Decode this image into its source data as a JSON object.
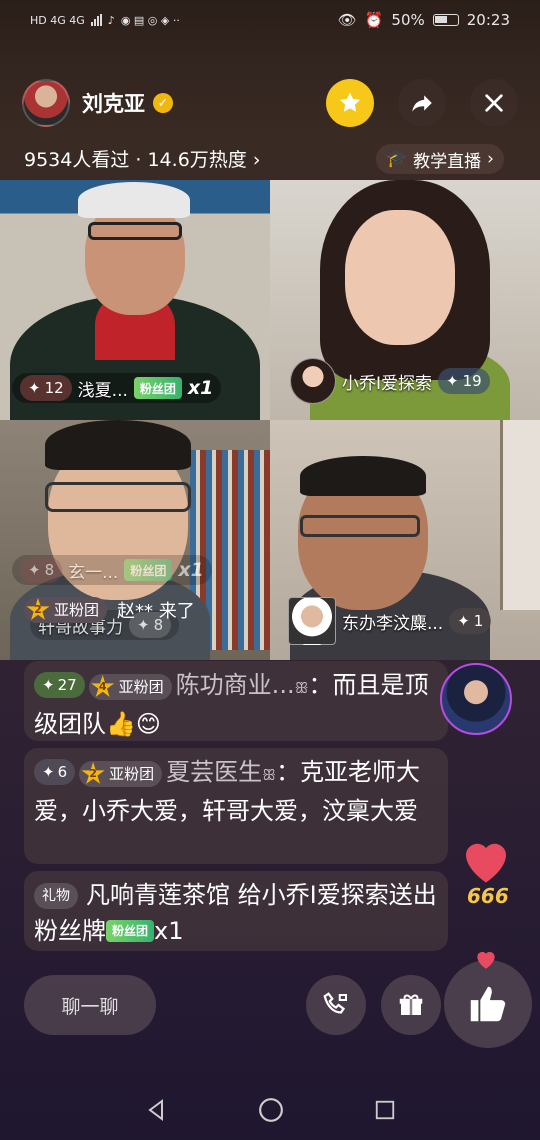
{
  "status": {
    "network": "HD 4G 4G",
    "battery": "50%",
    "time": "20:23"
  },
  "header": {
    "host_name": "刘克亚",
    "viewers": "9534人看过 · 14.6万热度",
    "category": "教学直播"
  },
  "tiles": [
    {
      "spark": "12",
      "name": "浅夏...",
      "fan_badge": "粉丝团",
      "multiplier": "x1"
    },
    {
      "name": "小乔I爱探索",
      "spark": "19"
    },
    {
      "spark": "8",
      "name": "玄一...",
      "fan_badge": "粉丝团",
      "multiplier": "x1",
      "overlay_name": "轩哥故事力",
      "overlay_spark": "8"
    },
    {
      "name": "东办李汶麋...",
      "spark": "1"
    }
  ],
  "join_notice": {
    "level": "2",
    "club": "亚粉团",
    "text": "赵** 来了"
  },
  "chat": [
    {
      "lvl": "27",
      "club_lvl": "4",
      "club": "亚粉团",
      "user": "陈功商业...",
      "text": "而且是顶级团队👍😊"
    },
    {
      "lvl": "6",
      "club_lvl": "2",
      "club": "亚粉团",
      "user": "夏芸医生",
      "text": "克亚老师大爱，小乔大爱，轩哥大爱，汶稟大爱"
    },
    {
      "tag": "礼物",
      "text": "凡响青莲茶馆 给小乔I爱探索送出粉丝牌",
      "fan_badge": "粉丝团",
      "multiplier": "x1"
    }
  ],
  "likes": {
    "count": "666"
  },
  "bottom": {
    "chat_placeholder": "聊一聊"
  },
  "colors": {
    "accent": "#f7c71a",
    "heart": "#e84a5f",
    "fan_badge": "#35b26e"
  }
}
